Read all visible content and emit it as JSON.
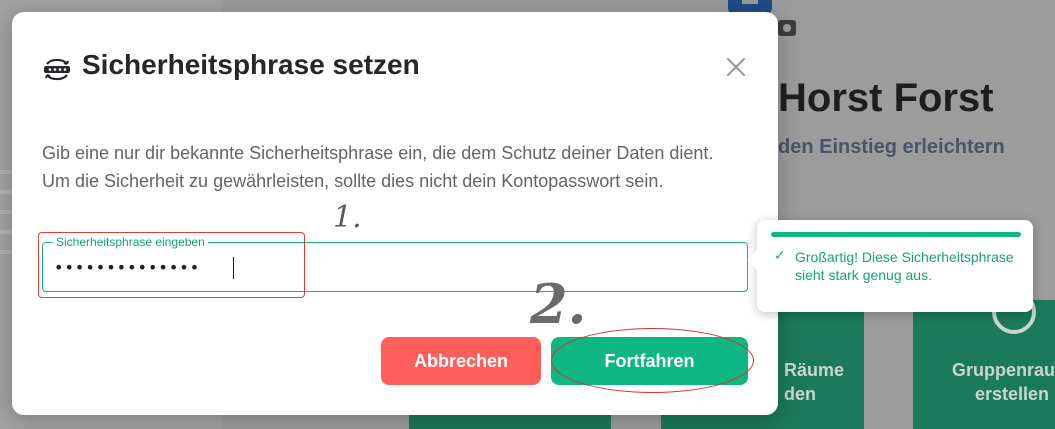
{
  "background": {
    "welcome_text": "Horst Forst",
    "subtitle_text": "den Einstieg erleichtern",
    "card_rooms_text": "Räume",
    "card_rooms_text2": "den",
    "card_group_text": "Gruppenrau",
    "card_group_text2": "erstellen"
  },
  "modal": {
    "title": "Sicherheitsphrase setzen",
    "title_icon": "key-sync-icon",
    "close_icon": "close-icon",
    "description": "Gib eine nur dir bekannte Sicherheitsphrase ein, die dem Schutz deiner Daten dient. Um die Sicherheit zu gewährleisten, sollte dies nicht dein Kontopasswort sein.",
    "field": {
      "label": "Sicherheitsphrase eingeben",
      "value": "••••••••••••••"
    },
    "buttons": {
      "cancel_label": "Abbrechen",
      "continue_label": "Fortfahren"
    }
  },
  "strength": {
    "message": "Großartig! Diese Sicherheitsphrase sieht stark genug aus.",
    "check_icon": "checkmark-icon"
  },
  "annotations": {
    "step1": "1.",
    "step2": "2."
  },
  "colors": {
    "accent": "#0eb682",
    "danger": "#ff5e5b",
    "annotation": "#e23b3b"
  }
}
